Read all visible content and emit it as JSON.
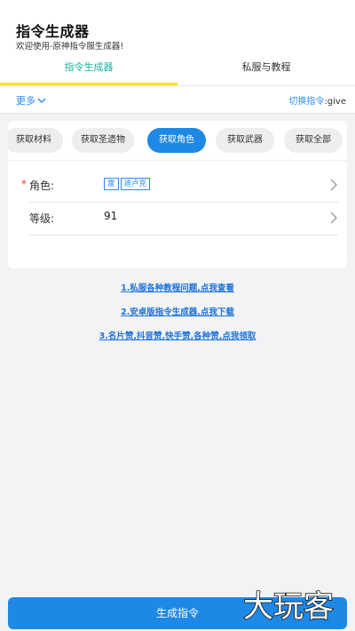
{
  "app": {
    "title": "指令生成器",
    "subtitle": "欢迎使用-原神指令服生成器!"
  },
  "tabs": [
    {
      "label": "指令生成器",
      "active": true
    },
    {
      "label": "私服与教程",
      "active": false
    }
  ],
  "toolbar": {
    "more_label": "更多",
    "switch_label": "切换指令",
    "switch_value": ":give"
  },
  "chips": [
    {
      "label": "获取材料",
      "selected": false
    },
    {
      "label": "获取圣遗物",
      "selected": false
    },
    {
      "label": "获取角色",
      "selected": true
    },
    {
      "label": "获取武器",
      "selected": false
    },
    {
      "label": "获取全部",
      "selected": false
    }
  ],
  "form": {
    "character": {
      "required_mark": "*",
      "label": "角色:",
      "tags": [
        "雷",
        "迪卢克"
      ]
    },
    "level": {
      "label": "等级:",
      "value": "91"
    }
  },
  "links": [
    "1.私服各种教程问题,点我查看",
    "2.安卓版指令生成器,点我下载",
    "3.名片赞,抖音赞,快手赞,各种赞,点我领取"
  ],
  "generate_button": "生成指令",
  "watermark_text": "大玩客",
  "colors": {
    "accent": "#1e88e5",
    "tab_active": "#1ab5a2",
    "tab_underline": "#ffe11f",
    "link": "#1e73d8",
    "required": "#e53935"
  }
}
